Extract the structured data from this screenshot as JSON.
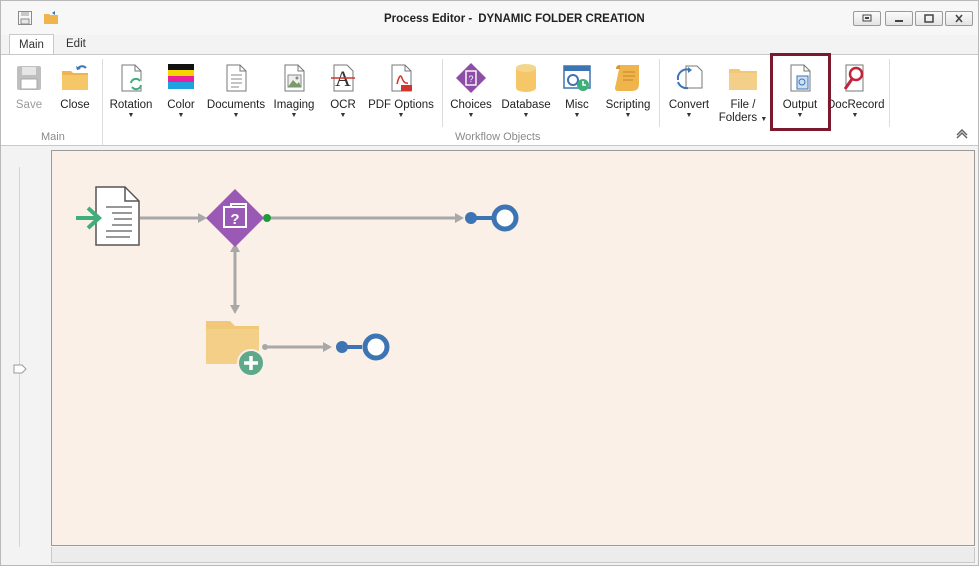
{
  "window": {
    "title_prefix": "Process Editor -",
    "title_name": "DYNAMIC FOLDER CREATION"
  },
  "tabs": [
    {
      "label": "Main"
    },
    {
      "label": "Edit"
    }
  ],
  "ribbon": {
    "main_group_label": "Main",
    "workflow_group_label": "Workflow Objects",
    "buttons": {
      "save": "Save",
      "close": "Close",
      "rotation": "Rotation",
      "color": "Color",
      "documents": "Documents",
      "imaging": "Imaging",
      "ocr": "OCR",
      "pdf_options": "PDF Options",
      "choices": "Choices",
      "database": "Database",
      "misc": "Misc",
      "scripting": "Scripting",
      "convert": "Convert",
      "file_folders_line1": "File /",
      "file_folders_line2": "Folders",
      "output": "Output",
      "docrecord": "DocRecord"
    }
  },
  "colors": {
    "highlight_border": "#7a1a2c",
    "canvas_bg": "#fbf0e7",
    "connector_gray": "#a8a8a8",
    "end_node_blue": "#3d74b4",
    "choice_purple": "#9b59b6",
    "folder_yellow": "#f1c878",
    "add_badge_green": "#5fa88a",
    "start_arrow_green": "#3fae7a"
  }
}
